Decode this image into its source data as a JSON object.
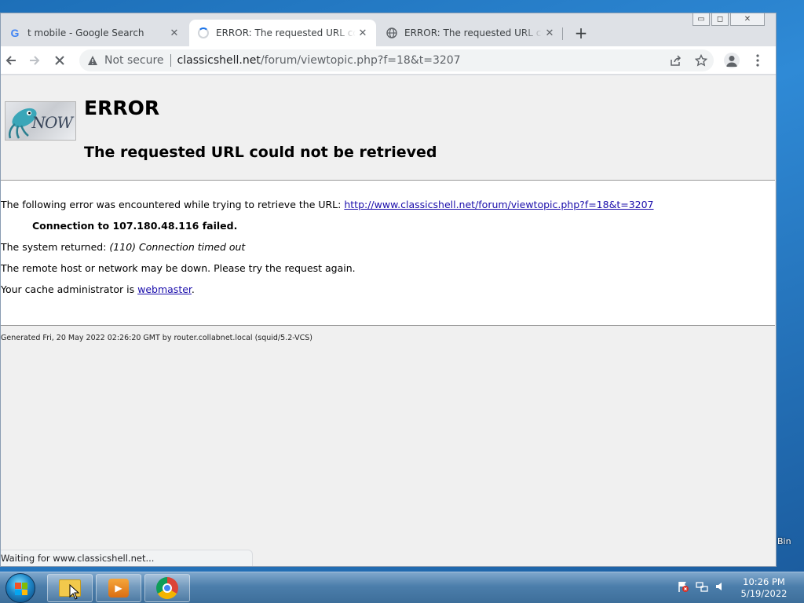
{
  "desktop": {
    "recycle_bin_partial_label": "Bin"
  },
  "window_controls": {
    "minimize": "▭",
    "maximize": "◻",
    "close": "✕"
  },
  "tabs": [
    {
      "title": "t mobile - Google Search",
      "icon": "google-g-icon",
      "close": "✕",
      "active": false
    },
    {
      "title": "ERROR: The requested URL could not be retrieved",
      "icon": "loading-spinner-icon",
      "close": "✕",
      "active": true
    },
    {
      "title": "ERROR: The requested URL could not be retrieved",
      "icon": "globe-icon",
      "close": "✕",
      "active": false
    }
  ],
  "toolbar": {
    "new_tab": "+",
    "security_label": "Not secure",
    "url_host": "classicshell.net",
    "url_path": "/forum/viewtopic.php?f=18&t=3207"
  },
  "page": {
    "logo_text": "NOW",
    "heading": "ERROR",
    "subheading": "The requested URL could not be retrieved",
    "intro_text": "The following error was encountered while trying to retrieve the URL: ",
    "intro_link": "http://www.classicshell.net/forum/viewtopic.php?f=18&t=3207",
    "connection_failed": "Connection to 107.180.48.116 failed.",
    "system_returned_label": "The system returned: ",
    "system_returned_value": "(110) Connection timed out",
    "remote_host_text": "The remote host or network may be down. Please try the request again.",
    "cache_admin_text": "Your cache administrator is ",
    "cache_admin_link": "webmaster",
    "cache_admin_suffix": ".",
    "footer": "Generated Fri, 20 May 2022 02:26:20 GMT by router.collabnet.local (squid/5.2-VCS)"
  },
  "status_bar": {
    "text": "Waiting for www.classicshell.net..."
  },
  "taskbar": {
    "time": "10:26 PM",
    "date": "5/19/2022",
    "pinned": [
      "folder-icon",
      "media-player-icon",
      "chrome-icon"
    ]
  }
}
